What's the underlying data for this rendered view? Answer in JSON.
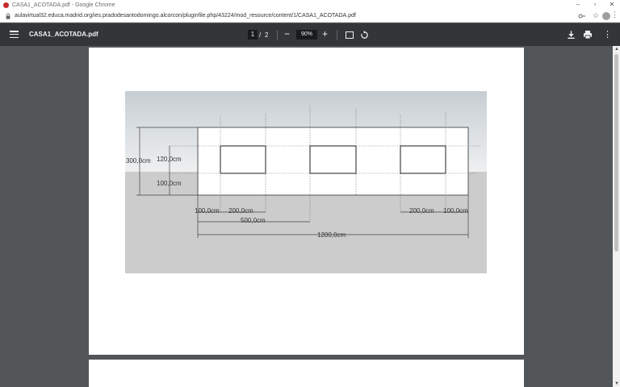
{
  "window": {
    "title": "CASA1_ACOTADA.pdf - Google Chrome",
    "controls": [
      "–",
      "▫",
      "✕"
    ]
  },
  "address": {
    "url": "aulavirtual32.educa.madrid.org/ies.pradodesantodomingo.alcorcon/pluginfile.php/43224/mod_resource/content/1/CASA1_ACOTADA.pdf"
  },
  "viewer": {
    "filename": "CASA1_ACOTADA.pdf",
    "current_page": "1",
    "page_separator": "/",
    "total_pages": "2",
    "zoom_minus": "−",
    "zoom": "90%",
    "zoom_plus": "+",
    "more": "⋮"
  },
  "drawing": {
    "dimensions": {
      "total_height": "300,0cm",
      "window_height": "120,0cm",
      "sill_height": "100,0cm",
      "left_margin": "100,0cm",
      "left_window_width": "200,0cm",
      "half_length": "500,0cm",
      "right_window_width": "200,0cm",
      "right_margin": "100,0cm",
      "total_length": "1200,0cm"
    }
  },
  "colors": {
    "toolbar": "#323639",
    "viewer_bg": "#525659",
    "sky_top": "#c7ced3",
    "ground": "#cccccc"
  }
}
